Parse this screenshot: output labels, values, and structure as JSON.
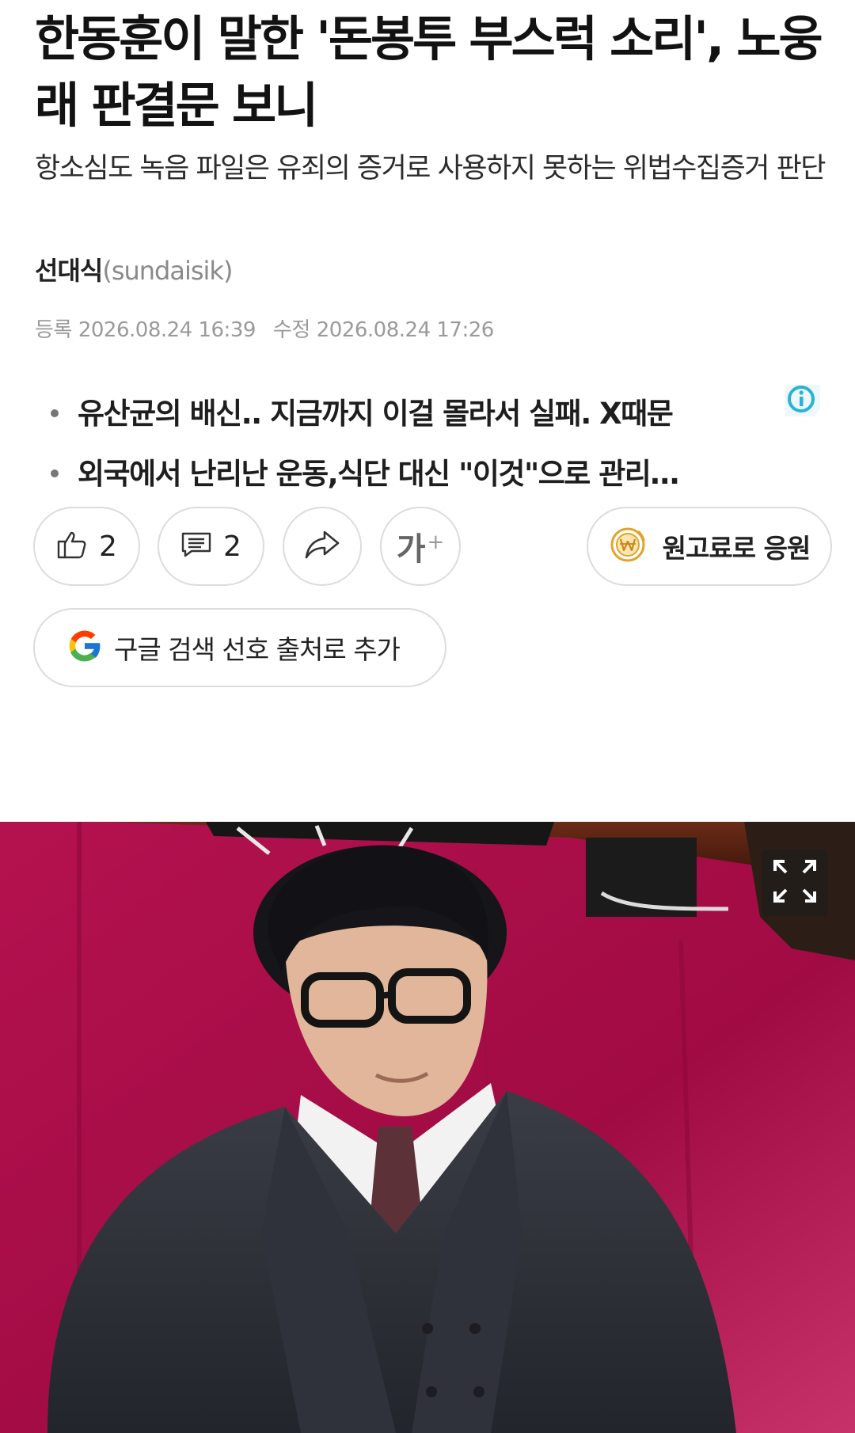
{
  "article": {
    "headline": "한동훈이 말한 '돈봉투 부스럭 소리', 노웅래 판결문 보니",
    "subheadline": "항소심도 녹음 파일은 유죄의 증거로 사용하지 못하는 위법수집증거 판단",
    "author": {
      "name": "선대식",
      "id": "(sundaisik)"
    },
    "registered": {
      "label": "등록",
      "value": "2026.08.24 16:39"
    },
    "modified": {
      "label": "수정",
      "value": "2026.08.24 17:26"
    }
  },
  "ads": {
    "badge_icon": "info-ad-icon",
    "items": [
      {
        "text": "유산균의 배신.. 지금까지 이걸 몰라서 실패. X때문"
      },
      {
        "text": "외국에서 난리난 운동,식단 대신 \"이것\"으로 관리…"
      }
    ]
  },
  "actions": {
    "like": {
      "icon": "thumbs-up-icon",
      "count": "2"
    },
    "comment": {
      "icon": "comment-icon",
      "count": "2"
    },
    "share": {
      "icon": "share-arrow-icon"
    },
    "font_size": {
      "label": "가",
      "plus": "+"
    },
    "donate": {
      "icon": "won-coin-icon",
      "label": "원고료로 응원"
    },
    "google": {
      "icon": "google-g-icon",
      "label": "구글 검색 선호 출처로 추가"
    }
  },
  "photo": {
    "expand_icon": "fullscreen-expand-icon"
  },
  "colors": {
    "border": "#dcdcdc",
    "meta_gray": "#9a9a9a",
    "coin_gold": "#e0a428",
    "ad_badge": "#28b3d6",
    "photo_backdrop": "#a50d45"
  }
}
